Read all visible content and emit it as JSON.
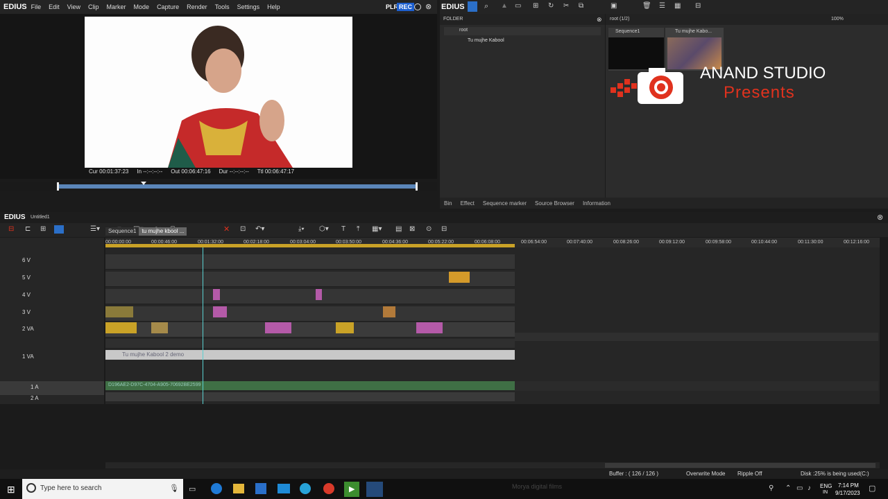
{
  "app": {
    "name": "EDIUS",
    "project": "Untitled1"
  },
  "menu": [
    "File",
    "Edit",
    "View",
    "Clip",
    "Marker",
    "Mode",
    "Capture",
    "Render",
    "Tools",
    "Settings",
    "Help"
  ],
  "recorder": {
    "plr": "PLR",
    "rec": "REC"
  },
  "preview": {
    "cur": "Cur 00:01:37:23",
    "in": "In --:--:--:--",
    "out": "Out 00:06:47:16",
    "dur": "Dur --:--:--:--",
    "ttl": "Ttl 00:06:47:17"
  },
  "folder": {
    "title": "FOLDER",
    "root": "root",
    "child": "Tu mujhe Kabool"
  },
  "assets": {
    "path": "root (1/2)",
    "zoom": "100%",
    "items": [
      "Sequence1",
      "Tu mujhe Kabo..."
    ]
  },
  "overlay": {
    "title": "ANAND STUDIO",
    "subtitle": "Presents"
  },
  "bin_tabs": [
    "Bin",
    "Effect",
    "Sequence marker",
    "Source Browser",
    "Information"
  ],
  "seq_tabs": [
    "Sequence1",
    "tu mujhe kbool ..."
  ],
  "ruler": [
    "00:00:00:00",
    "00:00:46:00",
    "00:01:32:00",
    "00:02:18:00",
    "00:03:04:00",
    "00:03:50:00",
    "00:04:36:00",
    "00:05:22:00",
    "00:06:08:00",
    "00:06:54:00",
    "00:07:40:00",
    "00:08:26:00",
    "00:09:12:00",
    "00:09:58:00",
    "00:10:44:00",
    "00:11:30:00",
    "00:12:16:00"
  ],
  "tracks": [
    "6 V",
    "5 V",
    "4 V",
    "3 V",
    "2 VA",
    "1 VA",
    "1 A",
    "2 A"
  ],
  "clips": {
    "main": "Tu mujhe Kabool 2 demo",
    "audio": "D196AE2-D97C-4704-A905-70692BE2599"
  },
  "status": {
    "buffer": "Buffer : ( 126 / 126 )",
    "mode": "Overwrite Mode",
    "ripple": "Ripple Off",
    "disk": "Disk :25% is being used(C:)"
  },
  "taskbar": {
    "search": "Type here to search",
    "ghost": "Morya digital films",
    "lang": "ENG",
    "region": "IN",
    "time": "7:14 PM",
    "date": "9/17/2023"
  }
}
